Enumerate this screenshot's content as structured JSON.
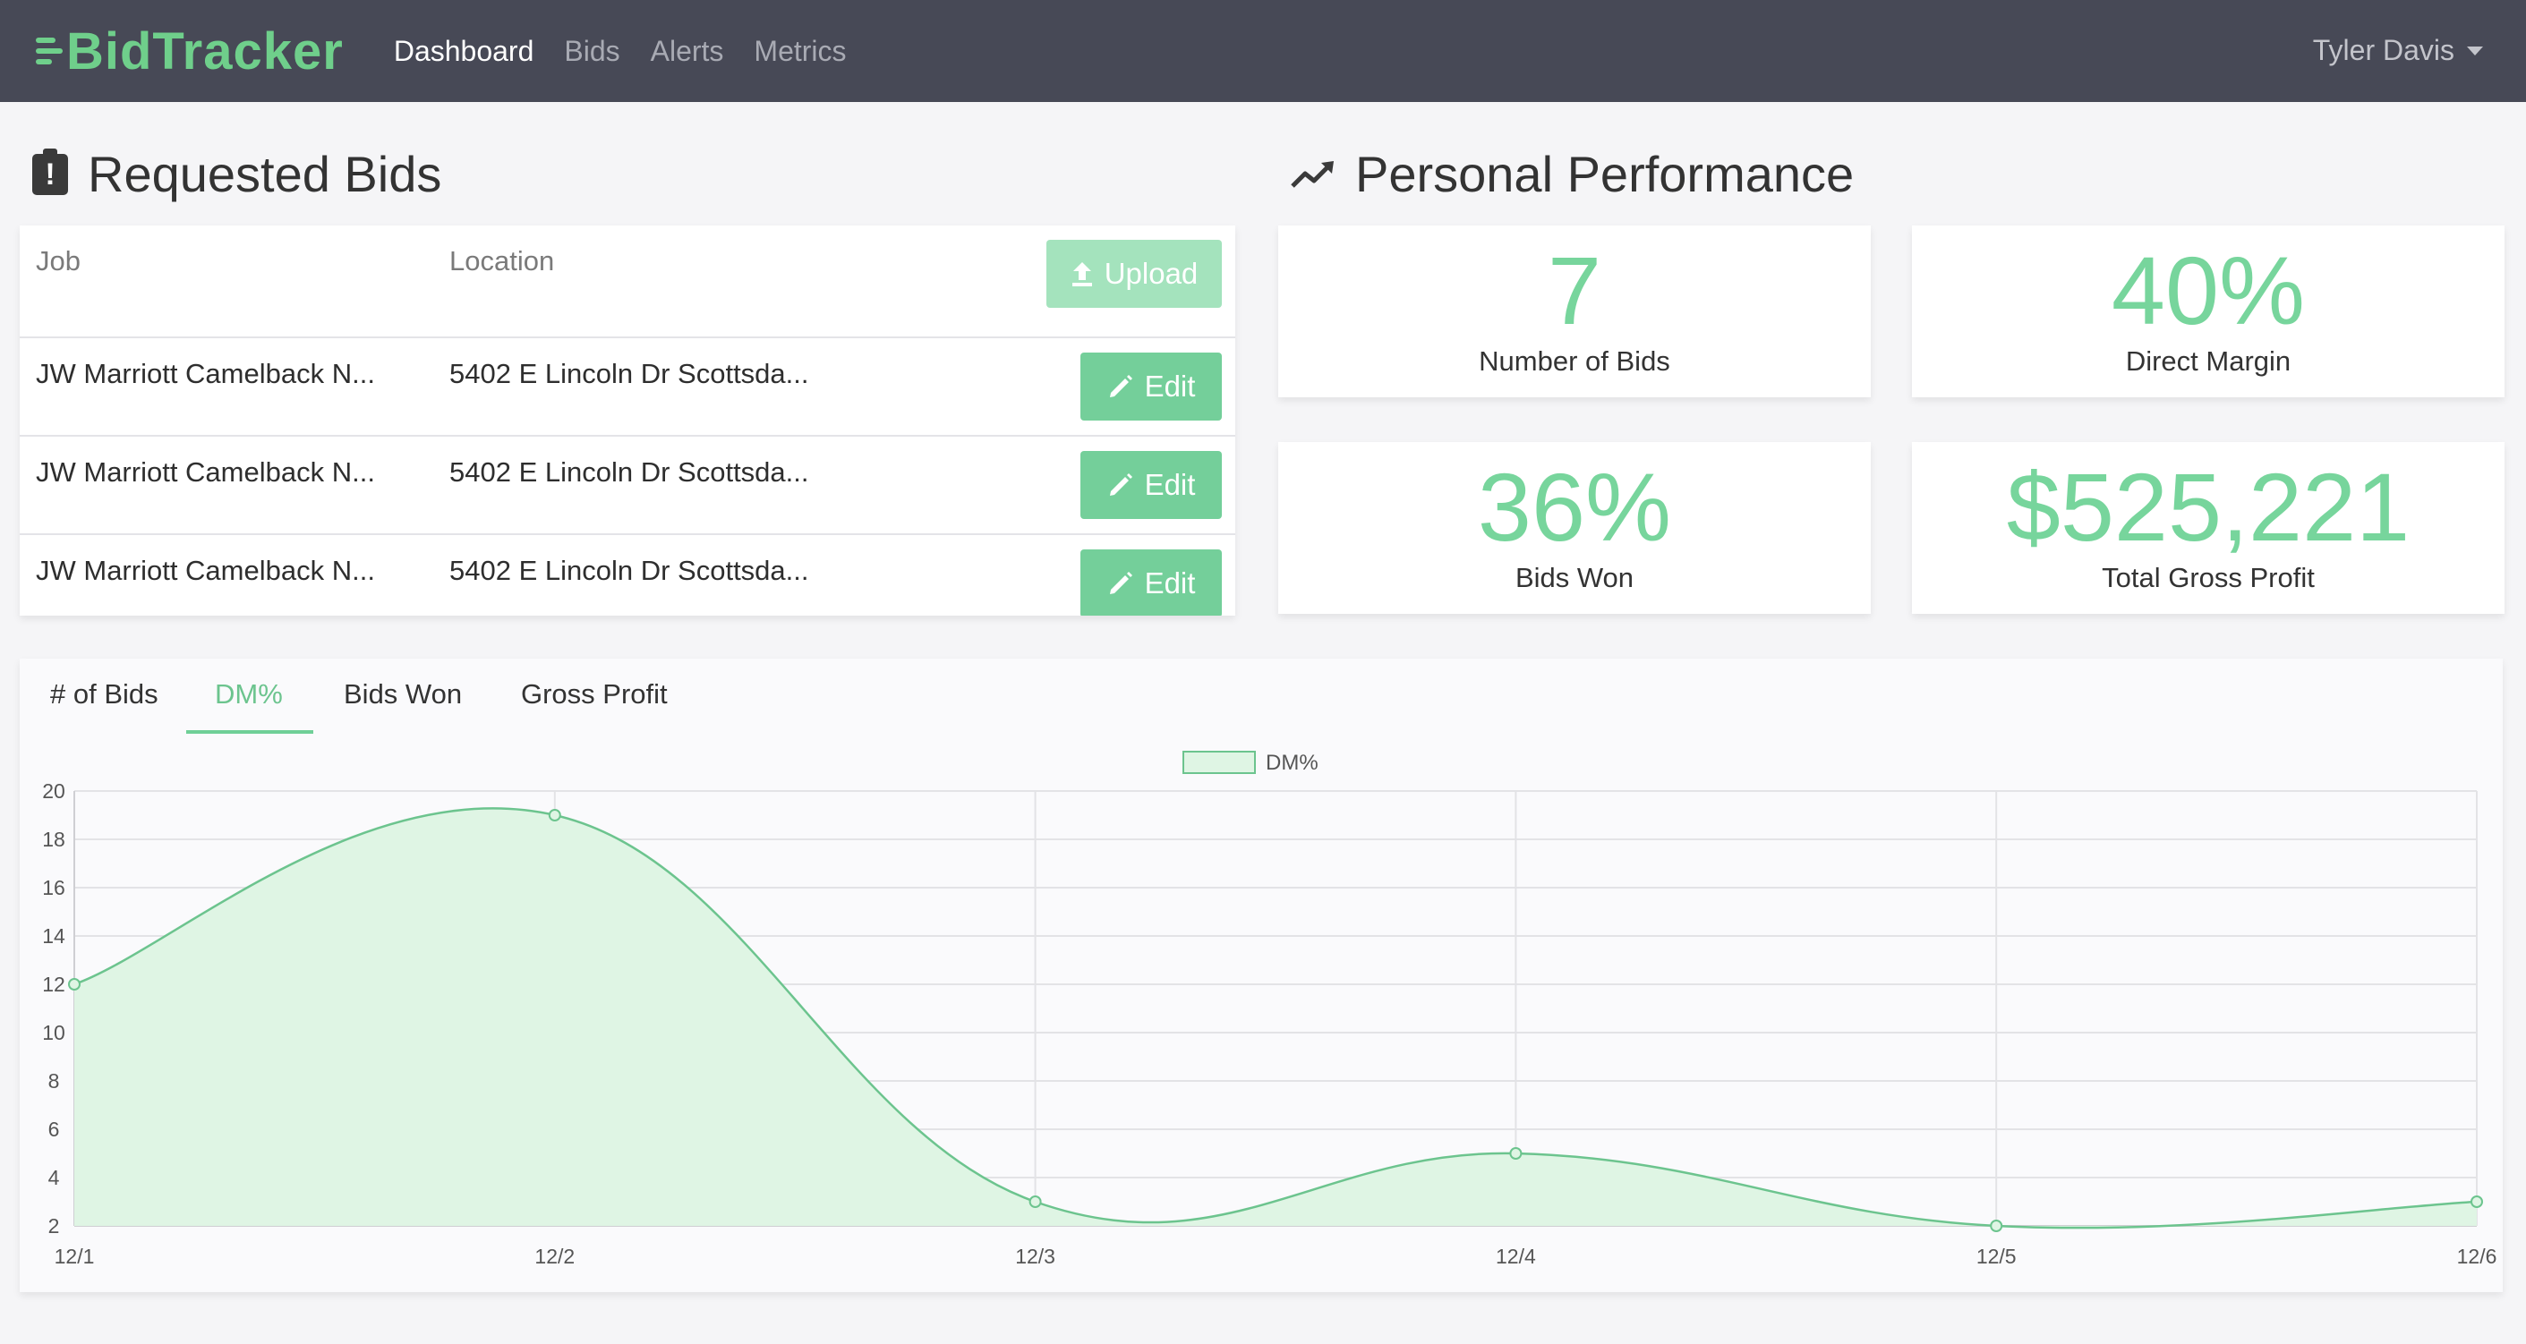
{
  "nav": {
    "brand": "BidTracker",
    "links": [
      "Dashboard",
      "Bids",
      "Alerts",
      "Metrics"
    ],
    "user": "Tyler Davis"
  },
  "requested_bids": {
    "title": "Requested Bids",
    "columns": {
      "job": "Job",
      "location": "Location"
    },
    "upload_label": "Upload",
    "edit_label": "Edit",
    "rows": [
      {
        "job": "JW Marriott Camelback N...",
        "location": "5402 E Lincoln Dr Scottsda..."
      },
      {
        "job": "JW Marriott Camelback N...",
        "location": "5402 E Lincoln Dr Scottsda..."
      },
      {
        "job": "JW Marriott Camelback N...",
        "location": "5402 E Lincoln Dr Scottsda..."
      }
    ]
  },
  "performance": {
    "title": "Personal Performance",
    "stats": [
      {
        "value": "7",
        "label": "Number of Bids"
      },
      {
        "value": "40%",
        "label": "Direct Margin"
      },
      {
        "value": "36%",
        "label": "Bids Won"
      },
      {
        "value": "$525,221",
        "label": "Total Gross Profit"
      }
    ]
  },
  "chart_tabs": [
    "# of Bids",
    "DM%",
    "Bids Won",
    "Gross Profit"
  ],
  "active_chart_tab": "DM%",
  "colors": {
    "accent": "#6fcf97",
    "navbar": "#474956",
    "fill": "#dff5e4",
    "line": "#6cc48e"
  },
  "chart_data": {
    "type": "area",
    "x": [
      "12/1",
      "12/2",
      "12/3",
      "12/4",
      "12/5",
      "12/6"
    ],
    "series": [
      {
        "name": "DM%",
        "values": [
          12,
          19,
          3,
          5,
          2,
          3
        ]
      }
    ],
    "ylim": [
      2,
      20
    ],
    "yticks": [
      2,
      4,
      6,
      8,
      10,
      12,
      14,
      16,
      18,
      20
    ],
    "grid": true,
    "legend": "top-center"
  }
}
